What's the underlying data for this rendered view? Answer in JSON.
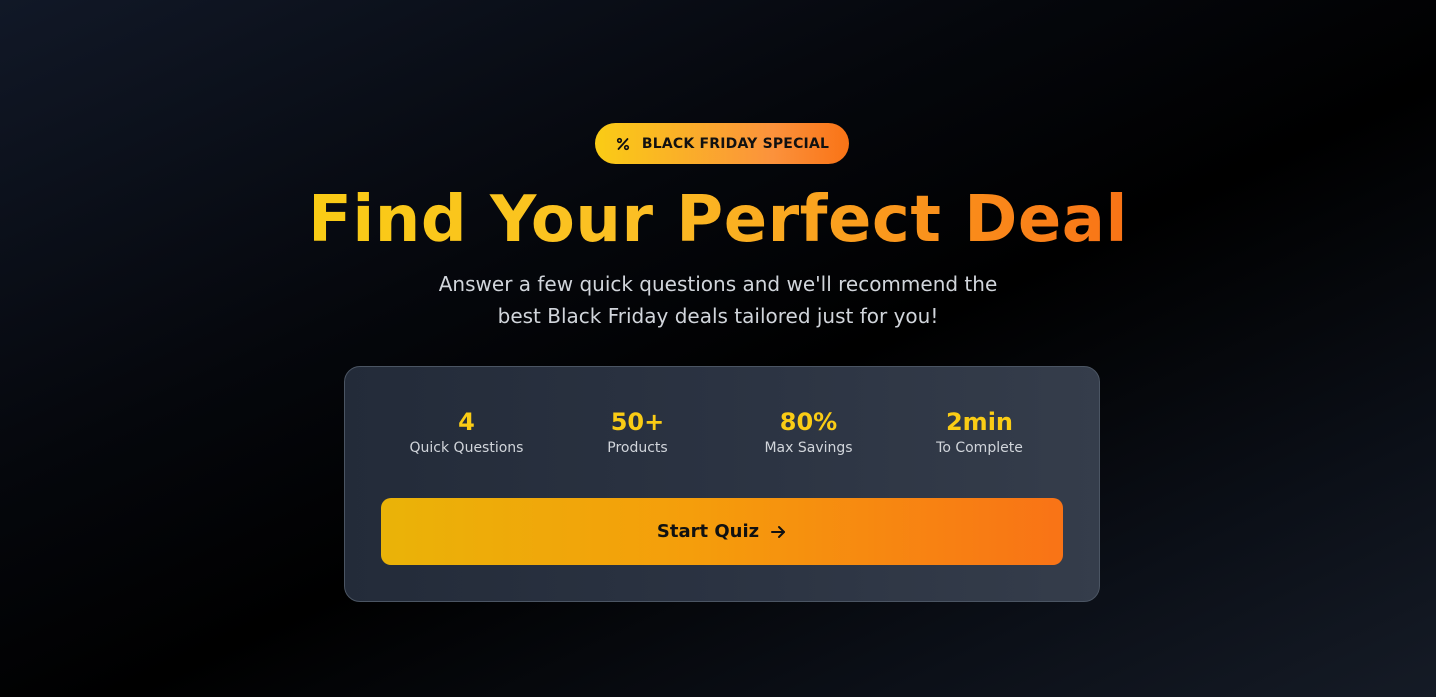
{
  "badge": {
    "icon": "percent-icon",
    "label": "BLACK FRIDAY SPECIAL"
  },
  "hero": {
    "title": "Find Your Perfect Deal",
    "subtitle_line1": "Answer a few quick questions and we'll recommend the",
    "subtitle_line2": "best Black Friday deals tailored just for you!"
  },
  "stats": [
    {
      "value": "4",
      "label": "Quick Questions"
    },
    {
      "value": "50+",
      "label": "Products"
    },
    {
      "value": "80%",
      "label": "Max Savings"
    },
    {
      "value": "2min",
      "label": "To Complete"
    }
  ],
  "cta": {
    "label": "Start Quiz",
    "icon": "arrow-right-icon"
  },
  "colors": {
    "accent_yellow": "#facc15",
    "accent_orange": "#f97316",
    "card_bg": "#2b3342",
    "page_bg": "#000000"
  }
}
